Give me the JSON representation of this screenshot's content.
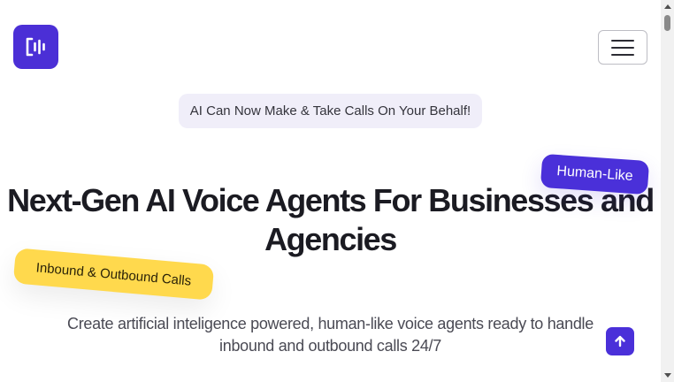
{
  "header": {
    "logo_icon": "voice-wave-logo-icon",
    "menu_icon": "hamburger-icon",
    "brand_color": "#4b2fd6"
  },
  "hero": {
    "announcement": "AI Can Now Make & Take Calls On Your Behalf!",
    "title_line1": "Next-Gen AI Voice Agents For Businesses and",
    "title_line2": "Agencies",
    "tag_human": "Human-Like",
    "tag_inbound": "Inbound & Outbound Calls",
    "subtitle_line1": "Create artificial inteligence powered, human-like voice agents ready to handle",
    "subtitle_line2": "inbound and outbound calls 24/7"
  },
  "controls": {
    "back_to_top_icon": "arrow-up-icon"
  },
  "colors": {
    "accent_purple": "#4a30d9",
    "accent_yellow": "#ffd94d",
    "announcement_bg": "#f0eef9"
  }
}
